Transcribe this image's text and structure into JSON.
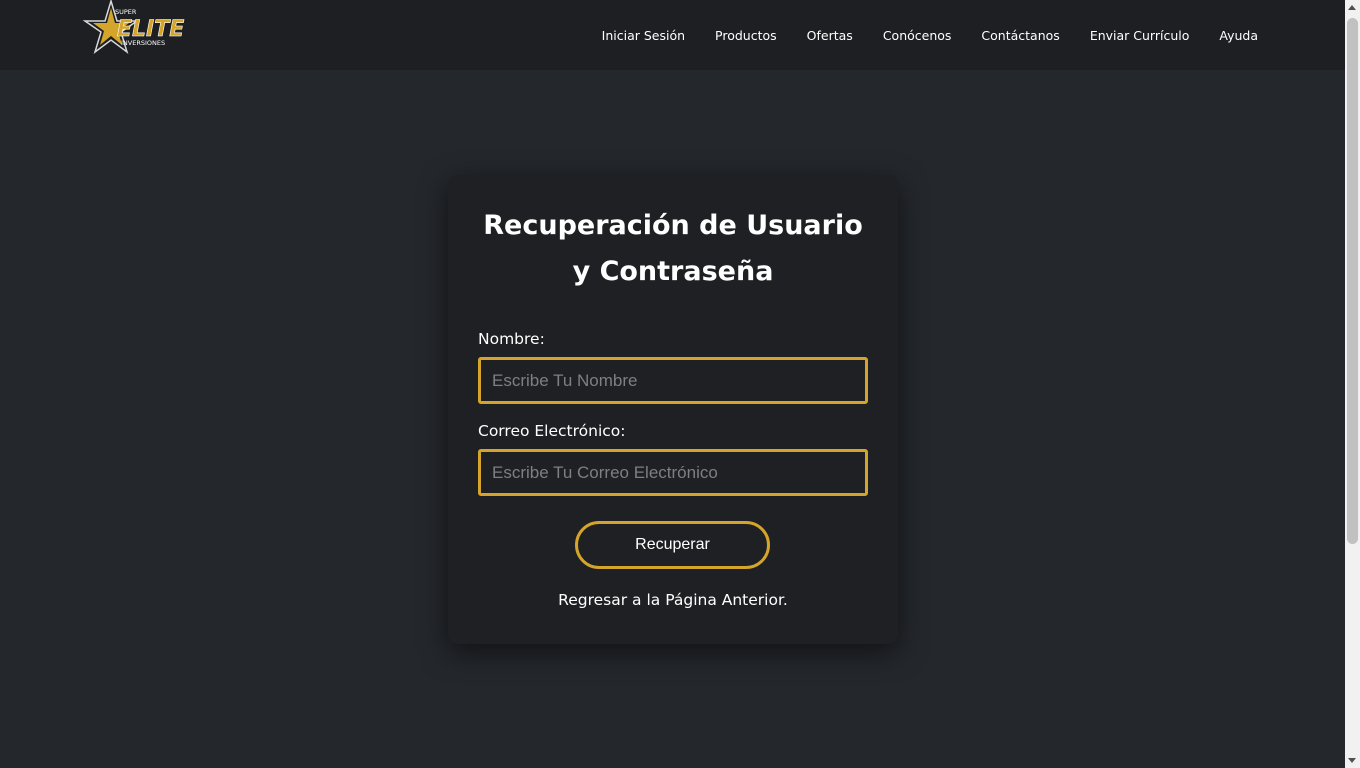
{
  "brand": {
    "top_word": "SUPER",
    "main_word": "ELITE",
    "bottom_word": "INVERSIONES",
    "accent_color": "#d4a52a"
  },
  "nav": {
    "items": [
      {
        "label": "Iniciar Sesión"
      },
      {
        "label": "Productos"
      },
      {
        "label": "Ofertas"
      },
      {
        "label": "Conócenos"
      },
      {
        "label": "Contáctanos"
      },
      {
        "label": "Enviar Currículo"
      },
      {
        "label": "Ayuda"
      }
    ]
  },
  "form": {
    "title": "Recuperación de Usuario y Contraseña",
    "name_label": "Nombre:",
    "name_placeholder": "Escribe Tu Nombre",
    "name_value": "",
    "email_label": "Correo Electrónico:",
    "email_placeholder": "Escribe Tu Correo Electrónico",
    "email_value": "",
    "submit_label": "Recuperar",
    "back_link": "Regresar a la Página Anterior."
  }
}
